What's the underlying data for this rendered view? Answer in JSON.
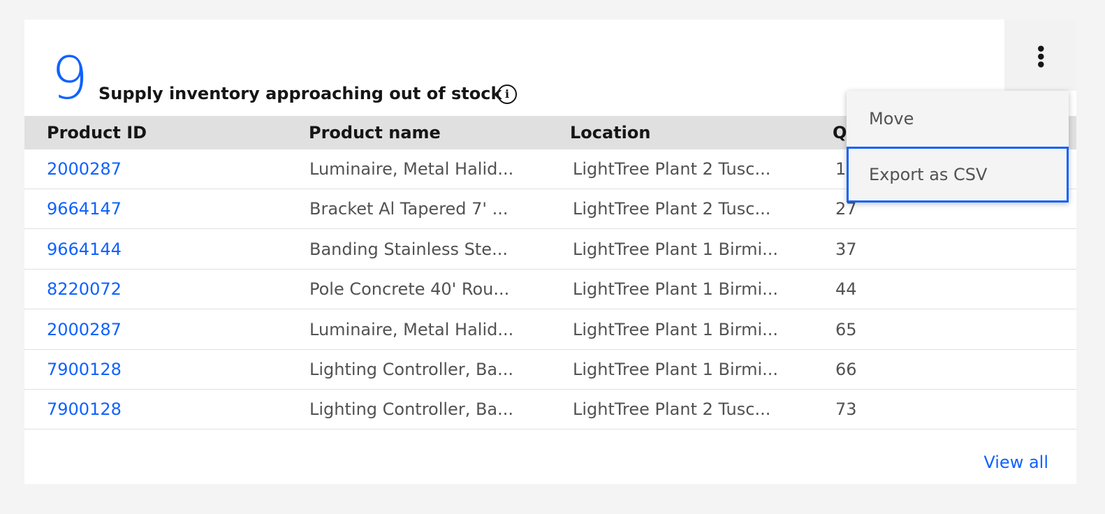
{
  "widget": {
    "count": "9",
    "title": "Supply inventory approaching out of stock",
    "info_icon": "information-icon",
    "overflow_icon": "overflow-menu-vertical-icon",
    "view_all_label": "View all"
  },
  "table": {
    "columns": [
      "Product ID",
      "Product name",
      "Location",
      "Q"
    ],
    "rows": [
      {
        "id": "2000287",
        "name": "Luminaire, Metal Halid...",
        "location": "LightTree Plant 2 Tusc...",
        "qty": "1"
      },
      {
        "id": "9664147",
        "name": "Bracket Al Tapered 7' ...",
        "location": "LightTree Plant 2 Tusc...",
        "qty": "27"
      },
      {
        "id": "9664144",
        "name": "Banding Stainless Ste...",
        "location": "LightTree Plant 1 Birmi...",
        "qty": "37"
      },
      {
        "id": "8220072",
        "name": "Pole Concrete 40' Rou...",
        "location": "LightTree Plant 1 Birmi...",
        "qty": "44"
      },
      {
        "id": "2000287",
        "name": "Luminaire, Metal Halid...",
        "location": "LightTree Plant 1 Birmi...",
        "qty": "65"
      },
      {
        "id": "7900128",
        "name": "Lighting Controller, Ba...",
        "location": "LightTree Plant 1 Birmi...",
        "qty": "66"
      },
      {
        "id": "7900128",
        "name": "Lighting Controller, Ba...",
        "location": "LightTree Plant 2 Tusc...",
        "qty": "73"
      }
    ]
  },
  "menu": {
    "items": [
      {
        "label": "Move",
        "focused": false
      },
      {
        "label": "Export as CSV",
        "focused": true
      }
    ]
  },
  "colors": {
    "link": "#0f62fe",
    "header_bg": "#e0e0e0",
    "focus_outline": "#0f62fe"
  }
}
